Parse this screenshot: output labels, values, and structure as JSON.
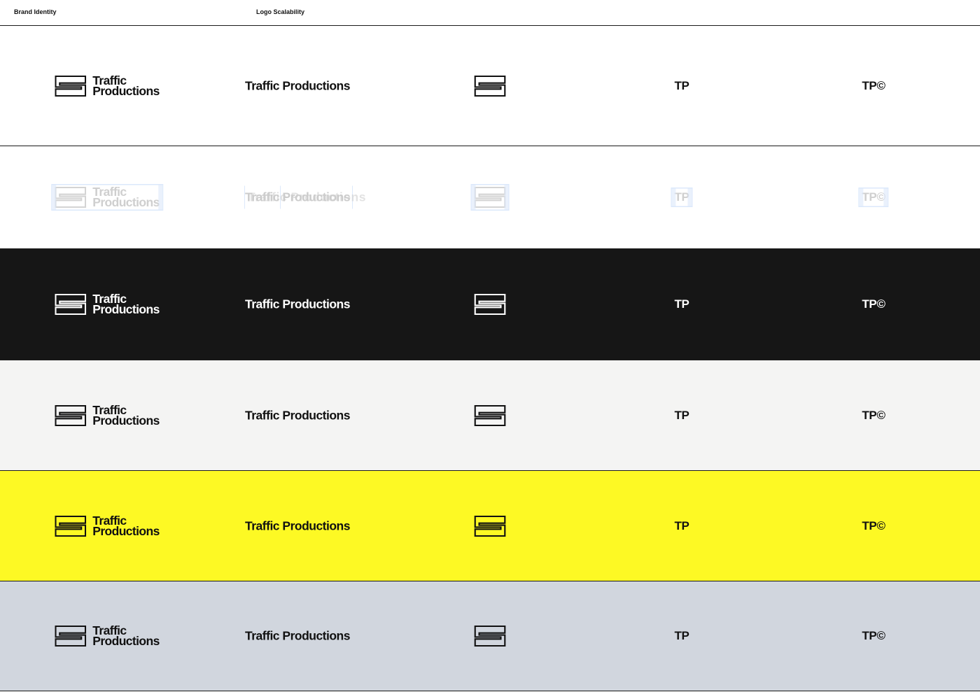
{
  "header": {
    "left_label": "Brand Identity",
    "center_label": "Logo Scalability"
  },
  "brand": {
    "name_line1": "Traffic",
    "name_line2": "Productions",
    "wordmark": "Traffic Productions",
    "monogram": "TP",
    "monogram_copyright": "TP©",
    "icon": "serpentine-stripes-icon"
  },
  "rows": [
    {
      "id": "white",
      "background": "#ffffff",
      "ink": "#111111",
      "variant": "standard"
    },
    {
      "id": "construction",
      "background": "#ffffff",
      "ink": "#cccccc",
      "variant": "construction-grid"
    },
    {
      "id": "black",
      "background": "#161616",
      "ink": "#ffffff",
      "variant": "standard"
    },
    {
      "id": "off-white",
      "background": "#f4f4f3",
      "ink": "#111111",
      "variant": "standard"
    },
    {
      "id": "yellow",
      "background": "#fdf924",
      "ink": "#111111",
      "variant": "standard"
    },
    {
      "id": "cool-gray",
      "background": "#d1d6de",
      "ink": "#111111",
      "variant": "standard"
    }
  ]
}
